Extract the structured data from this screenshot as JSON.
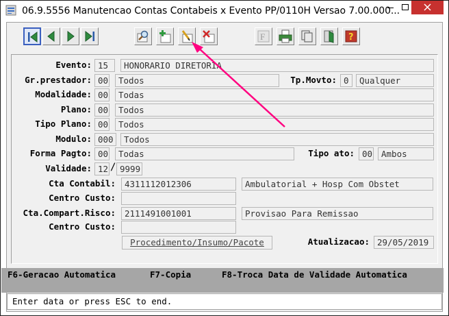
{
  "window": {
    "title": "06.9.5556 Manutencao  Contas Contabeis x Evento PP/0110H Versao 7.00.000...",
    "close_color": "#c7312f"
  },
  "toolbar": {
    "buttons": [
      {
        "name": "first-record-icon"
      },
      {
        "name": "previous-record-icon"
      },
      {
        "name": "next-record-icon"
      },
      {
        "name": "last-record-icon"
      },
      {
        "name": "search-icon"
      },
      {
        "name": "add-record-icon"
      },
      {
        "name": "edit-record-icon"
      },
      {
        "name": "delete-record-icon"
      },
      {
        "name": "filter-icon"
      },
      {
        "name": "print-icon"
      },
      {
        "name": "copy-icon"
      },
      {
        "name": "exit-icon"
      },
      {
        "name": "help-icon"
      }
    ]
  },
  "form": {
    "evento": {
      "label": "Evento:",
      "code": "15",
      "desc": "HONORARIO DIRETORIA"
    },
    "gr_prestador": {
      "label": "Gr.prestador:",
      "code": "00",
      "desc": "Todos"
    },
    "tp_movto": {
      "label": "Tp.Movto:",
      "code": "0",
      "desc": "Qualquer"
    },
    "modalidade": {
      "label": "Modalidade:",
      "code": "00",
      "desc": "Todas"
    },
    "plano": {
      "label": "Plano:",
      "code": "00",
      "desc": "Todos"
    },
    "tipo_plano": {
      "label": "Tipo Plano:",
      "code": "00",
      "desc": "Todos"
    },
    "modulo": {
      "label": "Modulo:",
      "code": "000",
      "desc": "Todos"
    },
    "forma_pagto": {
      "label": "Forma Pagto:",
      "code": "00",
      "desc": "Todas"
    },
    "tipo_ato": {
      "label": "Tipo ato:",
      "code": "00",
      "desc": "Ambos"
    },
    "validade": {
      "label": "Validade:",
      "month": "12",
      "sep": "/",
      "year": "9999"
    },
    "cta_contabil": {
      "label": "Cta Contabil:",
      "value": "4311112012306",
      "desc": "Ambulatorial + Hosp Com Obstet"
    },
    "centro_custo_1": {
      "label": "Centro Custo:",
      "value": ""
    },
    "cta_compart": {
      "label": "Cta.Compart.Risco:",
      "value": "2111491001001",
      "desc": "Provisao Para Remissao"
    },
    "centro_custo_2": {
      "label": "Centro Custo:",
      "value": ""
    },
    "procedimento_button": "Procedimento/Insumo/Pacote",
    "atualizacao": {
      "label": "Atualizacao:",
      "value": "29/05/2019"
    }
  },
  "function_keys": {
    "f6": "F6-Geracao Automatica",
    "f7": "F7-Copia",
    "f8": "F8-Troca Data de Validade Automatica"
  },
  "status_bar": "Enter data or press ESC to end.",
  "annotation_color": "#ff0080"
}
